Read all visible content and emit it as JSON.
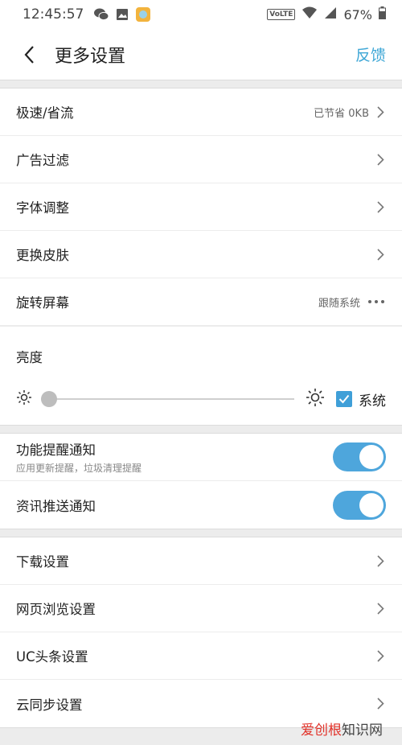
{
  "status": {
    "time": "12:45:57",
    "volte": "VoLTE",
    "battery": "67%"
  },
  "header": {
    "title": "更多设置",
    "feedback": "反馈"
  },
  "group1": {
    "items": [
      {
        "label": "极速/省流",
        "value": "已节省 0KB"
      },
      {
        "label": "广告过滤"
      },
      {
        "label": "字体调整"
      },
      {
        "label": "更换皮肤"
      },
      {
        "label": "旋转屏幕",
        "value": "跟随系统"
      }
    ],
    "brightness": {
      "label": "亮度",
      "level": 0.03,
      "system_label": "系统",
      "system_checked": true
    }
  },
  "group2": {
    "items": [
      {
        "label": "功能提醒通知",
        "sub": "应用更新提醒，垃圾清理提醒",
        "on": true
      },
      {
        "label": "资讯推送通知",
        "on": true
      }
    ]
  },
  "group3": {
    "items": [
      {
        "label": "下载设置"
      },
      {
        "label": "网页浏览设置"
      },
      {
        "label": "UC头条设置"
      },
      {
        "label": "云同步设置"
      }
    ]
  },
  "watermark": {
    "part1": "爱创根",
    "part2": "知识网"
  },
  "colors": {
    "accent": "#3fa7d6",
    "toggle_on": "#4ea6dc"
  }
}
